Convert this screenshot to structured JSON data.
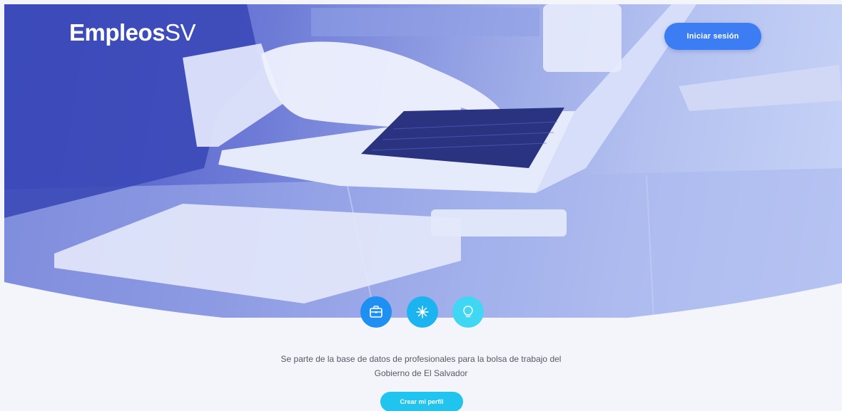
{
  "header": {
    "logo": {
      "part1": "Empleos",
      "part2": "SV"
    },
    "login_label": "Iniciar sesión"
  },
  "features": {
    "icons": [
      "briefcase-icon",
      "snowflake-icon",
      "lightbulb-icon"
    ]
  },
  "main": {
    "tagline_line1": "Se parte de la base de datos de profesionales para la bolsa de trabajo del",
    "tagline_line2": "Gobierno de El Salvador",
    "cta_label": "Crear mi perfil"
  },
  "colors": {
    "hero_overlay": "#5a66cf",
    "login_button": "#3d7df3",
    "icon_1": "#1f8ff2",
    "icon_2": "#1cb4f0",
    "icon_3": "#3fd7f4",
    "cta_button": "#20c4ee",
    "page_background": "#f3f5fa"
  }
}
